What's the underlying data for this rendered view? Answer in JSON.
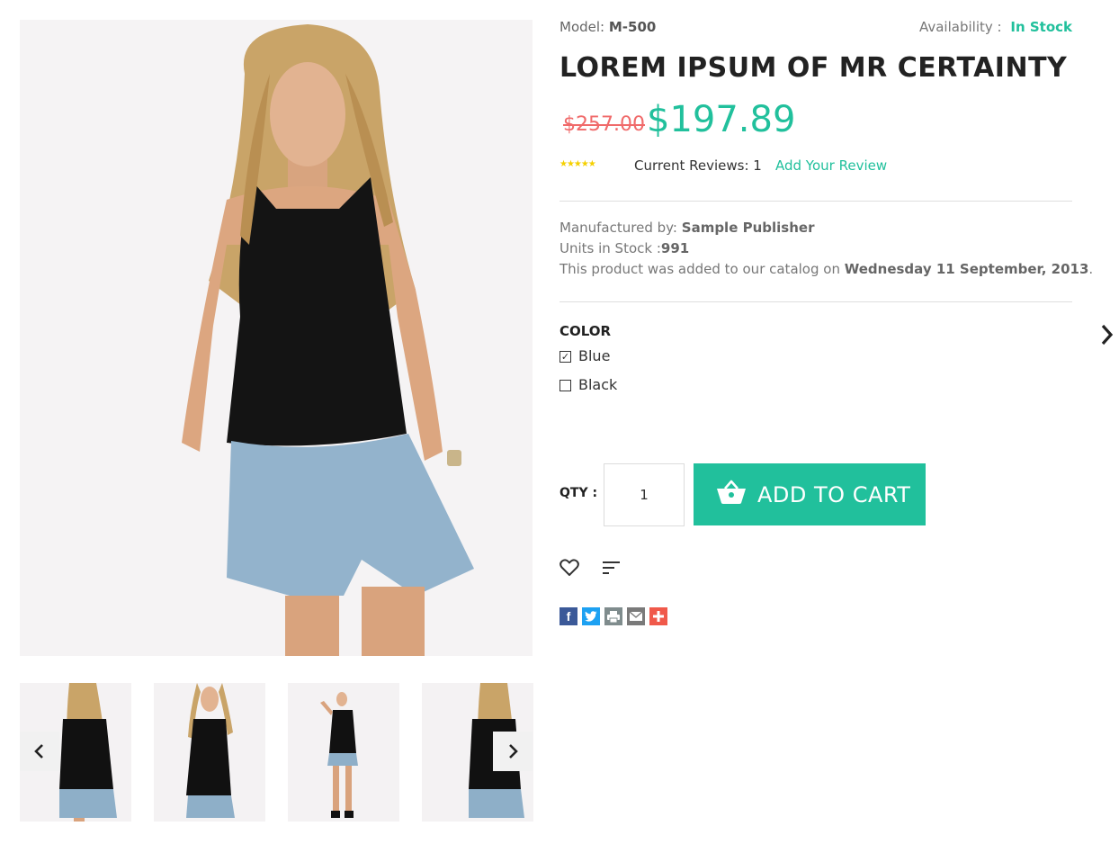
{
  "product": {
    "model_label": "Model:",
    "model_value": "M-500",
    "availability_label": "Availability :",
    "availability_value": "In Stock",
    "title": "LOREM IPSUM OF MR CERTAINTY",
    "old_price": "$257.00",
    "new_price": "$197.89",
    "rating_stars": "★★★★★",
    "rating": 5,
    "reviews_text": "Current Reviews: 1",
    "add_review": "Add Your Review"
  },
  "details": {
    "manufacturer_label": "Manufactured by:",
    "manufacturer_value": "Sample Publisher",
    "stock_label": "Units in Stock :",
    "stock_value": "991",
    "added_prefix": "This product was added to our catalog on",
    "added_date": "Wednesday 11 September, 2013",
    "added_suffix": "."
  },
  "options": {
    "heading": "COLOR",
    "items": [
      {
        "label": "Blue",
        "checked": true,
        "mark": "✓"
      },
      {
        "label": "Black",
        "checked": false,
        "mark": ""
      }
    ]
  },
  "cart": {
    "qty_label": "QTY :",
    "qty_value": "1",
    "button_label": "ADD TO CART"
  },
  "share": [
    {
      "name": "facebook-icon",
      "color": "#3b5998"
    },
    {
      "name": "twitter-icon",
      "color": "#1da1f2"
    },
    {
      "name": "print-icon",
      "color": "#7f8c8d"
    },
    {
      "name": "email-icon",
      "color": "#7a7a7a"
    },
    {
      "name": "plus-icon",
      "color": "#f0594a"
    }
  ],
  "colors": {
    "accent": "#21c09c",
    "old_price": "#f06a6a",
    "star": "#f5d000"
  },
  "icons": {
    "wishlist": "heart-icon",
    "compare": "compare-icon",
    "cart": "basket-icon",
    "gallery_next": "chevron-right-icon",
    "thumb_prev": "chevron-left-icon",
    "thumb_next": "chevron-right-icon"
  }
}
